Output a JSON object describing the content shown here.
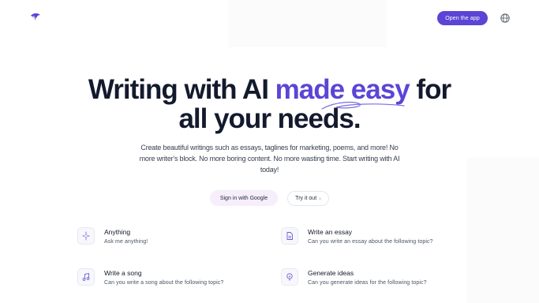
{
  "header": {
    "open_app_label": "Open the app",
    "logo_icon": "feather-logo-icon",
    "globe_icon": "globe-icon"
  },
  "hero": {
    "title_part1": "Writing with AI ",
    "title_accent": "made easy",
    "title_part2": " for",
    "title_line2": "all your needs.",
    "subtitle": "Create beautiful writings such as essays, taglines for marketing, poems, and more! No more writer's block. No more boring content. No more wasting time. Start writing with AI today!",
    "google_button": "Sign in with Google",
    "try_button": "Try it out"
  },
  "features": [
    {
      "title": "Anything",
      "desc": "Ask me anything!",
      "icon": "sparkle-icon"
    },
    {
      "title": "Write an essay",
      "desc": "Can you write an essay about the following topic?",
      "icon": "document-icon"
    },
    {
      "title": "Write a song",
      "desc": "Can you write a song about the following topic?",
      "icon": "music-note-icon"
    },
    {
      "title": "Generate ideas",
      "desc": "Can you generate ideas for the following topic?",
      "icon": "bulb-icon"
    }
  ],
  "colors": {
    "accent": "#5b45d6",
    "text": "#141a2e",
    "google_button_bg": "#f6eefb"
  }
}
